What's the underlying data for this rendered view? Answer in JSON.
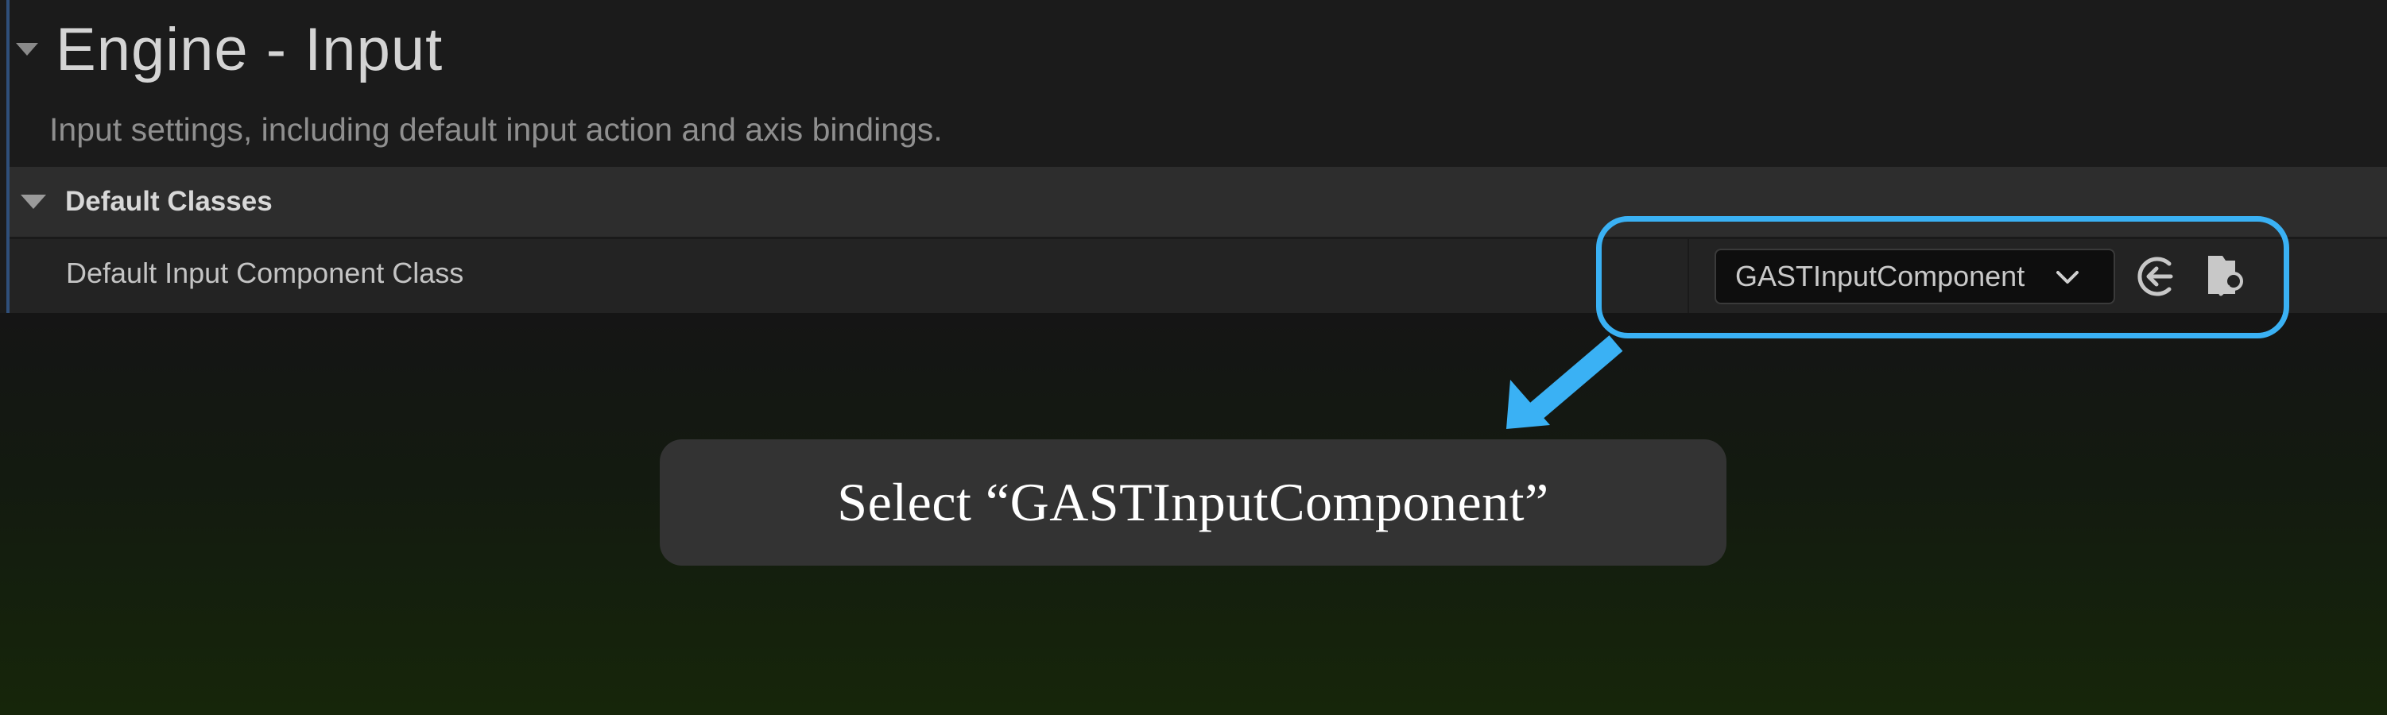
{
  "section": {
    "title": "Engine - Input",
    "subtitle": "Input settings, including default input action and axis bindings."
  },
  "category": {
    "label": "Default Classes"
  },
  "property": {
    "label": "Default Input Component Class",
    "value": "GASTInputComponent"
  },
  "icons": {
    "collapse": "triangle-down-icon",
    "dropdown": "chevron-down-icon",
    "use_selected": "left-arrow-circle-icon",
    "browse": "folder-search-icon"
  },
  "callout": {
    "text": "Select “GASTInputComponent”"
  },
  "colors": {
    "highlight": "#3ab1f4",
    "background": "#1b1b1b",
    "callout_bg": "#333333"
  }
}
